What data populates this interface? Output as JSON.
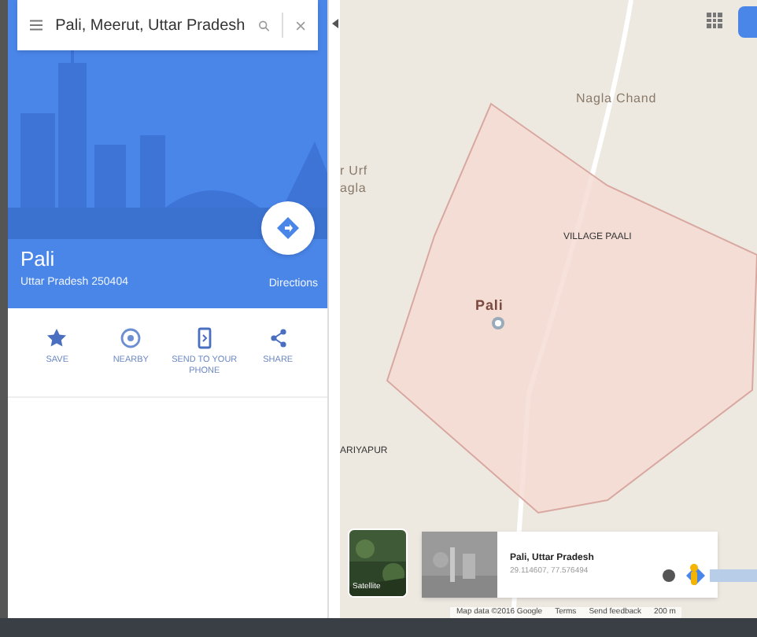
{
  "search": {
    "value": "Pali, Meerut, Uttar Pradesh"
  },
  "place": {
    "name": "Pali",
    "address": "Uttar Pradesh 250404",
    "directions_label": "Directions"
  },
  "actions": [
    {
      "label": "SAVE",
      "kind": "star"
    },
    {
      "label": "NEARBY",
      "kind": "nearby"
    },
    {
      "label": "SEND TO YOUR PHONE",
      "kind": "phone"
    },
    {
      "label": "SHARE",
      "kind": "share"
    }
  ],
  "map": {
    "labels": [
      {
        "text": "Nagla Chand",
        "kind": "town"
      },
      {
        "text": "r Urf",
        "kind": "town"
      },
      {
        "text": "agla",
        "kind": "town"
      },
      {
        "text": "VILLAGE PAALI",
        "kind": "village"
      },
      {
        "text": "Pali",
        "kind": "area"
      },
      {
        "text": "ARIYAPUR",
        "kind": "village"
      }
    ],
    "layer_toggle": {
      "label": "Satellite"
    },
    "info_card": {
      "title": "Pali, Uttar Pradesh",
      "coords": "29.114607, 77.576494"
    },
    "footer": [
      "Map data ©2016 Google",
      "Terms",
      "Send feedback",
      "200 m"
    ]
  }
}
